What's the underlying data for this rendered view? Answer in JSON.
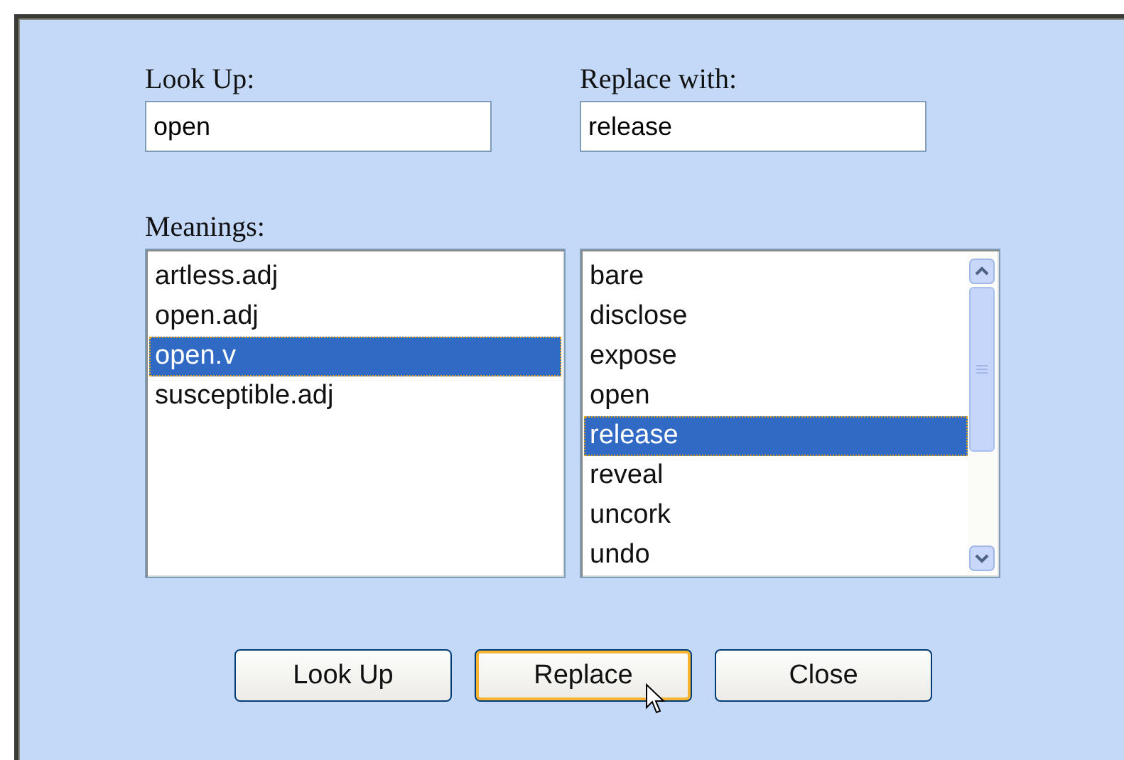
{
  "fields": [
    {
      "label": "Look Up:",
      "value": "open"
    },
    {
      "label": "Replace with:",
      "value": "release"
    }
  ],
  "meanings": {
    "label": "Meanings:",
    "items": [
      {
        "text": "artless.adj",
        "selected": false
      },
      {
        "text": "open.adj",
        "selected": false
      },
      {
        "text": "open.v",
        "selected": true
      },
      {
        "text": "susceptible.adj",
        "selected": false
      }
    ]
  },
  "synonyms": {
    "items": [
      {
        "text": "bare",
        "selected": false
      },
      {
        "text": "disclose",
        "selected": false
      },
      {
        "text": "expose",
        "selected": false
      },
      {
        "text": "open",
        "selected": false
      },
      {
        "text": "release",
        "selected": true
      },
      {
        "text": "reveal",
        "selected": false
      },
      {
        "text": "uncork",
        "selected": false
      },
      {
        "text": "undo",
        "selected": false
      }
    ]
  },
  "buttons": [
    {
      "label": "Look Up",
      "hovered": false
    },
    {
      "label": "Replace",
      "hovered": true
    },
    {
      "label": "Close",
      "hovered": false
    }
  ]
}
